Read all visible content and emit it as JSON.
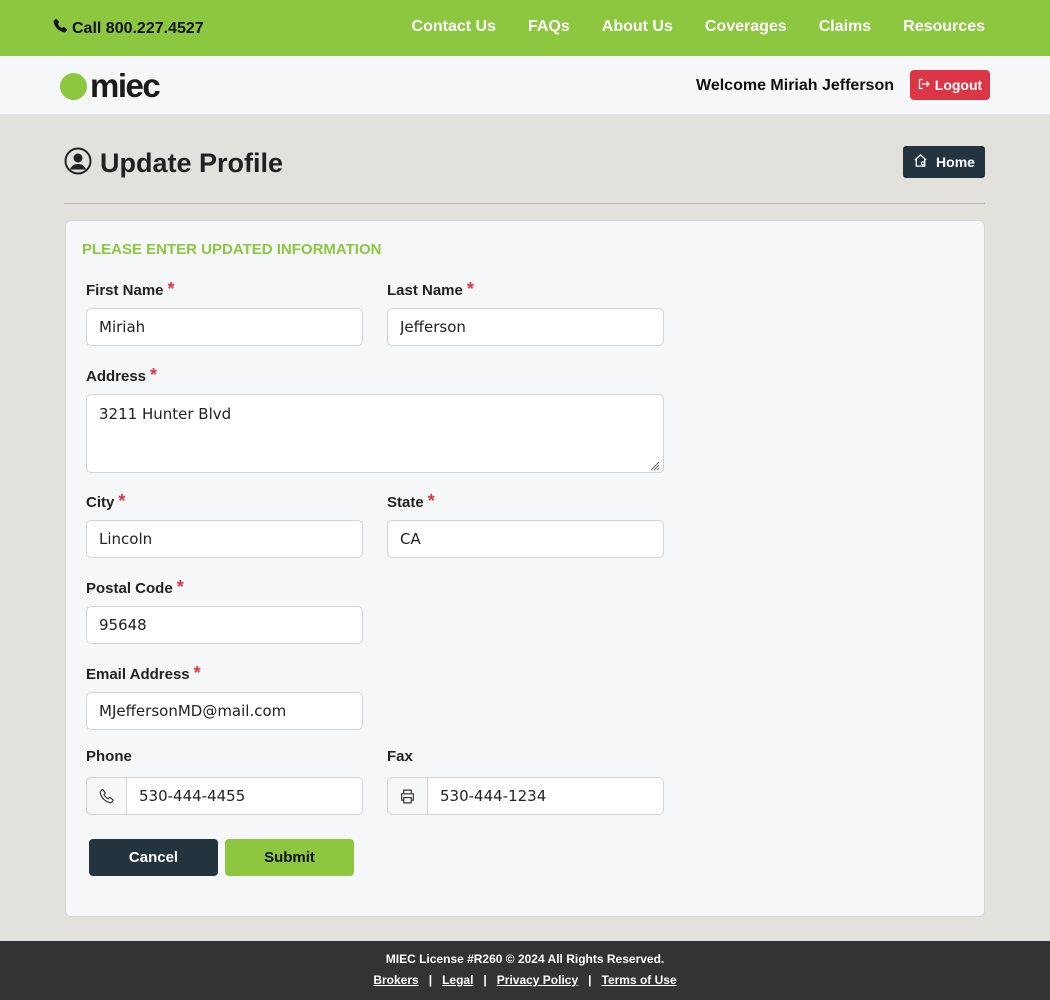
{
  "topbar": {
    "phone": "Call 800.227.4527",
    "nav": [
      "Contact Us",
      "FAQs",
      "About Us",
      "Coverages",
      "Claims",
      "Resources"
    ]
  },
  "header": {
    "logo_text": "miec",
    "welcome": "Welcome Miriah Jefferson",
    "logout_label": "Logout"
  },
  "page": {
    "title": "Update Profile",
    "home_label": "Home"
  },
  "form": {
    "heading": "PLEASE ENTER UPDATED INFORMATION",
    "required_mark": "*",
    "first_name": {
      "label": "First Name",
      "value": "Miriah"
    },
    "last_name": {
      "label": "Last Name",
      "value": "Jefferson"
    },
    "address": {
      "label": "Address",
      "value": "3211 Hunter Blvd"
    },
    "city": {
      "label": "City",
      "value": "Lincoln"
    },
    "state": {
      "label": "State",
      "value": "CA"
    },
    "postal_code": {
      "label": "Postal Code",
      "value": "95648"
    },
    "email": {
      "label": "Email Address",
      "value": "MJeffersonMD@mail.com"
    },
    "phone": {
      "label": "Phone",
      "value": "530-444-4455",
      "icon": "phone-icon"
    },
    "fax": {
      "label": "Fax",
      "value": "530-444-1234",
      "icon": "printer-icon"
    },
    "cancel_label": "Cancel",
    "submit_label": "Submit"
  },
  "footer": {
    "copyright": "MIEC License #R260 © 2024 All Rights Reserved.",
    "links": [
      "Brokers",
      "Legal",
      "Privacy Policy",
      "Terms of Use"
    ],
    "separator": "|"
  },
  "colors": {
    "brand_green": "#8dc63f",
    "dark_navy": "#24343f",
    "danger_red": "#dc3545",
    "footer_bg": "#333333"
  }
}
